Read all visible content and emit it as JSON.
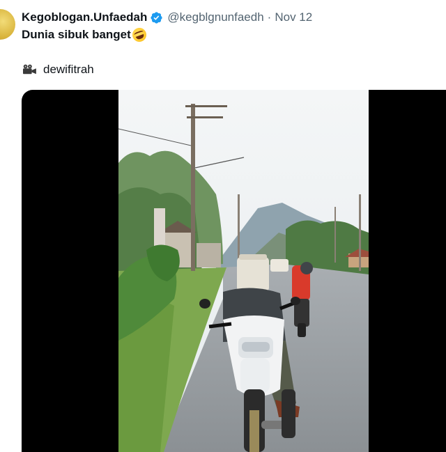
{
  "tweet": {
    "display_name": "Kegoblogan.Unfaedah",
    "handle": "@kegblgnunfaedh",
    "separator": "·",
    "timestamp": "Nov 12",
    "text": "Dunia sibuk banget",
    "emoji": "rolling-on-floor-laughing-emoji",
    "verified": true
  },
  "credit": {
    "icon": "movie-camera-icon",
    "name": "dewifitrah"
  },
  "media": {
    "type": "video",
    "background": "#000000"
  },
  "colors": {
    "text_primary": "#0f1419",
    "text_secondary": "#536471",
    "verified_blue": "#1d9bf0"
  }
}
